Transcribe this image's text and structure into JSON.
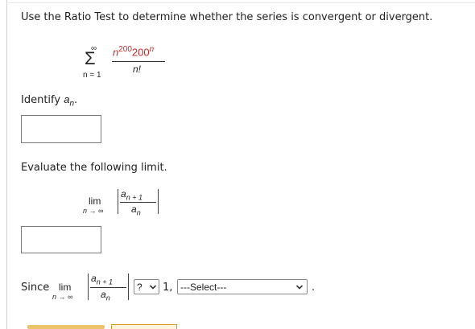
{
  "question": "Use the Ratio Test to determine whether the series is convergent or divergent.",
  "series": {
    "sum_symbol": "Σ",
    "upper_limit": "∞",
    "lower_limit": "n = 1",
    "numerator_base1": "n",
    "numerator_exp1": "200",
    "numerator_base2": "200",
    "numerator_exp2": "n",
    "denominator": "n!"
  },
  "identify": {
    "label": "Identify",
    "var": "a",
    "sub": "n",
    "suffix": "."
  },
  "evaluate": {
    "label": "Evaluate the following limit."
  },
  "limit": {
    "lim": "lim",
    "under": "n → ∞",
    "num_var": "a",
    "num_sub": "n + 1",
    "den_var": "a",
    "den_sub": "n"
  },
  "since": {
    "label": "Since",
    "compare_value": "?",
    "one": "1,",
    "select_value": "---Select---",
    "end": "."
  }
}
